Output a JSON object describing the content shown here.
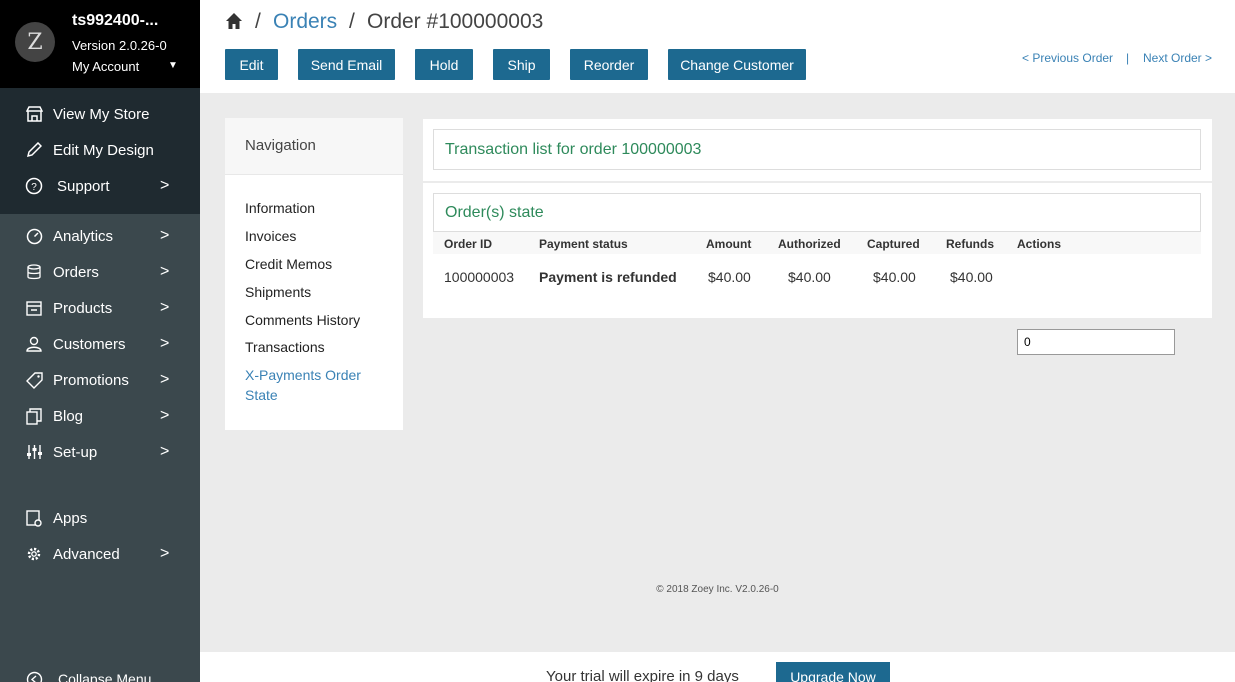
{
  "account": {
    "store_name": "ts992400-...",
    "version": "Version 2.0.26-0",
    "my_account_label": "My Account",
    "logo_letter": "Z"
  },
  "sidebar": {
    "top_items": [
      {
        "label": "View My Store",
        "icon": "store-icon"
      },
      {
        "label": "Edit My Design",
        "icon": "pencil-icon"
      },
      {
        "label": "Support",
        "icon": "help-circle-icon",
        "has_children": true
      }
    ],
    "items": [
      {
        "label": "Analytics",
        "icon": "gauge-icon"
      },
      {
        "label": "Orders",
        "icon": "database-icon"
      },
      {
        "label": "Products",
        "icon": "box-icon"
      },
      {
        "label": "Customers",
        "icon": "user-icon"
      },
      {
        "label": "Promotions",
        "icon": "tag-icon"
      },
      {
        "label": "Blog",
        "icon": "copy-icon"
      },
      {
        "label": "Set-up",
        "icon": "sliders-icon"
      }
    ],
    "bottom_items": [
      {
        "label": "Apps",
        "icon": "apps-icon"
      },
      {
        "label": "Advanced",
        "icon": "gear-icon"
      }
    ],
    "collapse_label": "Collapse Menu"
  },
  "breadcrumb": {
    "orders": "Orders",
    "order": "Order #100000003",
    "sep": "/"
  },
  "toolbar": {
    "edit": "Edit",
    "send_email": "Send Email",
    "hold": "Hold",
    "ship": "Ship",
    "reorder": "Reorder",
    "change_customer": "Change Customer"
  },
  "pager": {
    "previous": "< Previous Order",
    "separator": "|",
    "next": "Next Order >"
  },
  "navigation": {
    "title": "Navigation",
    "items": [
      "Information",
      "Invoices",
      "Credit Memos",
      "Shipments",
      "Comments History",
      "Transactions"
    ],
    "active_line1": "X-Payments Order",
    "active_line2": "State"
  },
  "transactions": {
    "title": "Transaction list for order 100000003"
  },
  "order_state": {
    "title": "Order(s) state",
    "columns": [
      "Order ID",
      "Payment status",
      "Amount",
      "Authorized",
      "Captured",
      "Refunds",
      "Actions"
    ],
    "row": {
      "order_id": "100000003",
      "payment_status": "Payment is refunded",
      "amount": "$40.00",
      "authorized": "$40.00",
      "captured": "$40.00",
      "refunds": "$40.00",
      "action_value": "0"
    }
  },
  "footer": {
    "copyright": "© 2018 Zoey Inc. V2.0.26-0"
  },
  "trial": {
    "text": "Your trial will expire in 9 days",
    "upgrade": "Upgrade Now"
  }
}
